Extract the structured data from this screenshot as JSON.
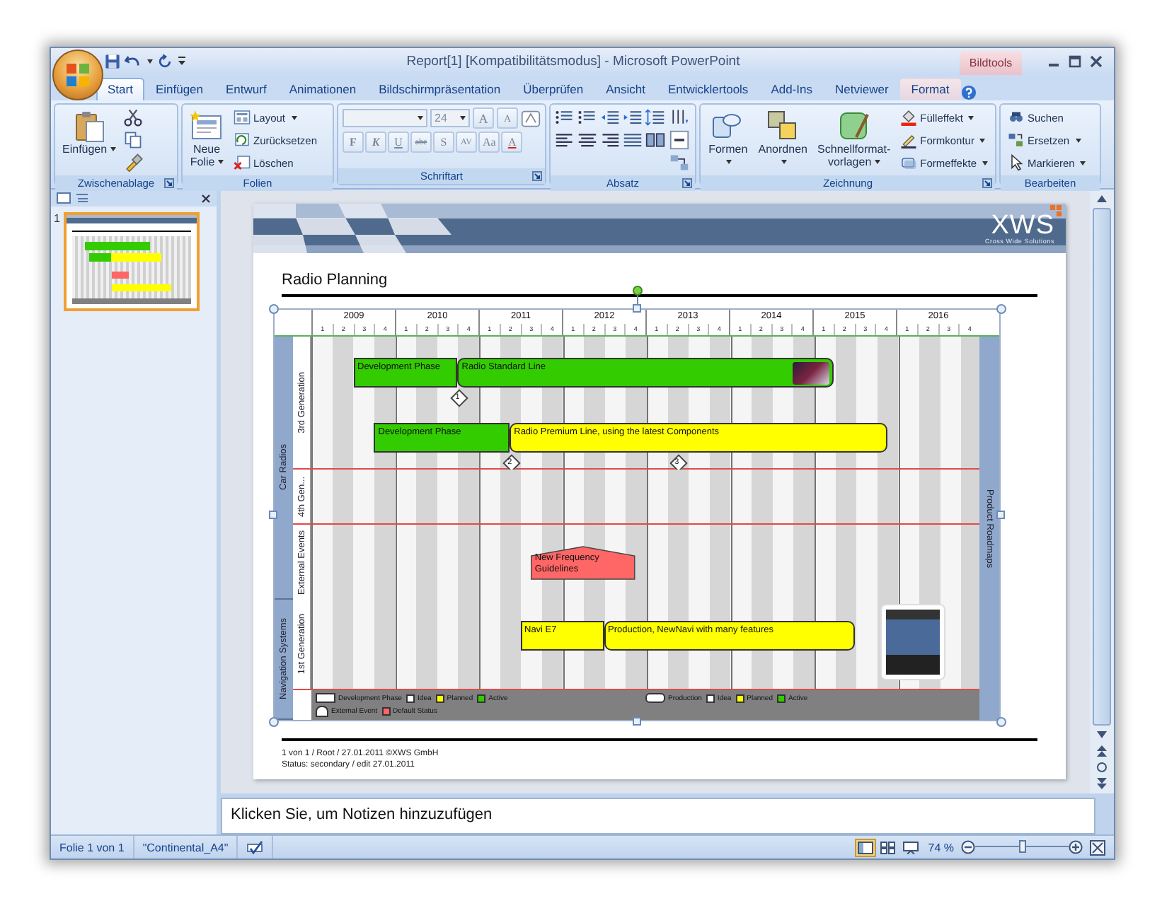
{
  "window": {
    "title": "Report[1] [Kompatibilitätsmodus] - Microsoft PowerPoint",
    "context_tab_group": "Bildtools"
  },
  "ribbon_tabs": [
    {
      "label": "Start",
      "selected": true
    },
    {
      "label": "Einfügen",
      "selected": false
    },
    {
      "label": "Entwurf",
      "selected": false
    },
    {
      "label": "Animationen",
      "selected": false
    },
    {
      "label": "Bildschirmpräsentation",
      "selected": false
    },
    {
      "label": "Überprüfen",
      "selected": false
    },
    {
      "label": "Ansicht",
      "selected": false
    },
    {
      "label": "Entwicklertools",
      "selected": false
    },
    {
      "label": "Add-Ins",
      "selected": false
    },
    {
      "label": "Netviewer",
      "selected": false
    },
    {
      "label": "Format",
      "selected": false
    }
  ],
  "ribbon_groups": [
    {
      "label": "Zwischenablage",
      "launcher": true,
      "buttons": [
        {
          "label": "Einfügen",
          "dropdown": true
        }
      ]
    },
    {
      "label": "Folien",
      "launcher": false,
      "buttons": [
        {
          "label": "Neue Folie",
          "dropdown": true
        },
        {
          "label": "Layout",
          "dropdown": true
        },
        {
          "label": "Zurücksetzen",
          "dropdown": false
        },
        {
          "label": "Löschen",
          "dropdown": false
        }
      ]
    },
    {
      "label": "Schriftart",
      "launcher": true,
      "disabled": true,
      "font_size": "24",
      "size_buttons": [
        "A",
        "A"
      ],
      "format_buttons": [
        "F",
        "K",
        "U",
        "abe",
        "S",
        "AV",
        "Aa",
        "A"
      ]
    },
    {
      "label": "Absatz",
      "launcher": true
    },
    {
      "label": "Zeichnung",
      "launcher": true,
      "buttons": [
        {
          "label": "Formen",
          "dropdown": true
        },
        {
          "label": "Anordnen",
          "dropdown": true
        },
        {
          "label": "Schnellformat-vorlagen",
          "dropdown": true
        },
        {
          "label": "Fülleffekt",
          "dropdown": true
        },
        {
          "label": "Formkontur",
          "dropdown": true
        },
        {
          "label": "Formeffekte",
          "dropdown": true
        }
      ]
    },
    {
      "label": "Bearbeiten",
      "launcher": false,
      "buttons": [
        {
          "label": "Suchen",
          "dropdown": false
        },
        {
          "label": "Ersetzen",
          "dropdown": true
        },
        {
          "label": "Markieren",
          "dropdown": true
        }
      ]
    }
  ],
  "slide_pane": {
    "slides": [
      {
        "number": "1",
        "selected": true
      }
    ]
  },
  "slide": {
    "logo": {
      "text": "XWS",
      "tagline": "Cross Wide Solutions"
    },
    "title": "Radio Planning",
    "chart": {
      "years": [
        {
          "label": "2009",
          "quarters": [
            "1",
            "2",
            "3",
            "4"
          ]
        },
        {
          "label": "2010",
          "quarters": [
            "1",
            "2",
            "3",
            "4"
          ]
        },
        {
          "label": "2011",
          "quarters": [
            "1",
            "2",
            "3",
            "4"
          ]
        },
        {
          "label": "2012",
          "quarters": [
            "1",
            "2",
            "3",
            "4"
          ]
        },
        {
          "label": "2013",
          "quarters": [
            "1",
            "2",
            "3",
            "4"
          ]
        },
        {
          "label": "2014",
          "quarters": [
            "1",
            "2",
            "3",
            "4"
          ]
        },
        {
          "label": "2015",
          "quarters": [
            "1",
            "2",
            "3",
            "4"
          ]
        },
        {
          "label": "2016",
          "quarters": [
            "1",
            "2",
            "3",
            "4"
          ]
        }
      ],
      "right_label": "Product Roadmaps",
      "groups": [
        {
          "label": "Car Radios",
          "rows": [
            {
              "label": "3rd Generation",
              "lanes": [
                {
                  "items": [
                    {
                      "kind": "development",
                      "label": "Development Phase",
                      "color": "#33cc00"
                    },
                    {
                      "kind": "production",
                      "label": "Radio Standard Line",
                      "color": "#33cc00",
                      "photo": true
                    },
                    {
                      "kind": "milestone",
                      "label": "1"
                    }
                  ]
                },
                {
                  "items": [
                    {
                      "kind": "development",
                      "label": "Development Phase",
                      "color": "#33cc00"
                    },
                    {
                      "kind": "production",
                      "label": "Radio Premium Line, using the latest  Components",
                      "color": "#ffff00",
                      "photo": false
                    },
                    {
                      "kind": "milestone",
                      "label": "2"
                    },
                    {
                      "kind": "milestone",
                      "label": "3"
                    }
                  ]
                }
              ]
            },
            {
              "label": "4th Gen...",
              "lanes": []
            },
            {
              "label": "External Events",
              "lanes": [
                {
                  "items": [
                    {
                      "kind": "event",
                      "label": "New Frequency Guidelines",
                      "color": "#ff6666"
                    }
                  ]
                }
              ]
            }
          ]
        },
        {
          "label": "Navigation Systems",
          "rows": [
            {
              "label": "1st Generation",
              "lanes": [
                {
                  "items": [
                    {
                      "kind": "development",
                      "label": "Navi E7",
                      "color": "#ffff00"
                    },
                    {
                      "kind": "production",
                      "label": "Production, NewNavi with many features",
                      "color": "#ffff00",
                      "photo": false
                    },
                    {
                      "kind": "photo"
                    }
                  ]
                }
              ]
            }
          ]
        }
      ],
      "legend": [
        {
          "entries": [
            {
              "kind": "development",
              "label": "Development Phase"
            },
            {
              "kind": "status",
              "color": "#ffffff",
              "label": "Idea"
            },
            {
              "kind": "status",
              "color": "#ffff00",
              "label": "Planned"
            },
            {
              "kind": "status",
              "color": "#33cc00",
              "label": "Active"
            }
          ]
        },
        {
          "entries": [
            {
              "kind": "production",
              "label": "Production"
            },
            {
              "kind": "status",
              "color": "#ffffff",
              "label": "Idea"
            },
            {
              "kind": "status",
              "color": "#ffff00",
              "label": "Planned"
            },
            {
              "kind": "status",
              "color": "#33cc00",
              "label": "Active"
            }
          ]
        },
        {
          "entries": [
            {
              "kind": "event",
              "label": "External Event"
            },
            {
              "kind": "status",
              "color": "#ff6666",
              "label": "Default Status"
            }
          ]
        }
      ]
    },
    "footer": [
      "1 von 1 / Root / 27.01.2011 ©XWS GmbH",
      "Status: secondary / edit 27.01.2011"
    ]
  },
  "notes": {
    "placeholder": "Klicken Sie, um Notizen hinzuzufügen"
  },
  "status_bar": {
    "slide": "Folie 1 von 1",
    "theme": "\"Continental_A4\"",
    "views": [
      {
        "selected": true
      },
      {
        "selected": false
      },
      {
        "selected": false
      }
    ],
    "zoom": "74 %",
    "zoom_slider": {
      "level": 0.5
    }
  }
}
